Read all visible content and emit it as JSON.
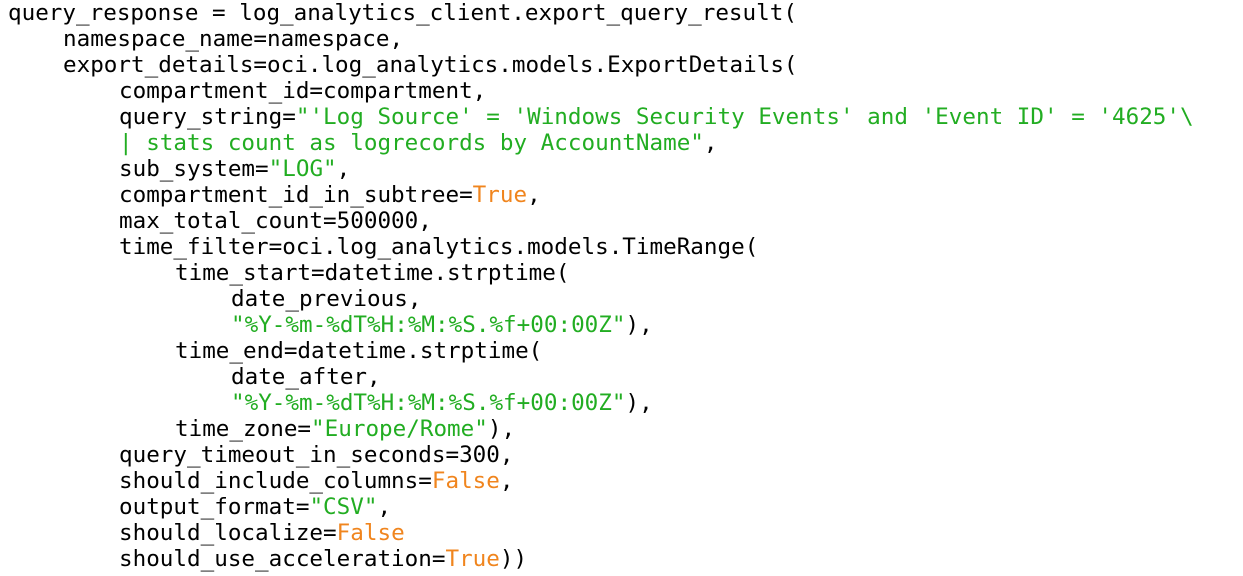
{
  "colors": {
    "background": "#ffffff",
    "default_text": "#000000",
    "string": "#22ad22",
    "keyword": "#f0851e"
  },
  "code_lines": [
    {
      "indent": 0,
      "tokens": [
        {
          "t": "plain",
          "v": "query_response = log_analytics_client.export_query_result("
        }
      ]
    },
    {
      "indent": 1,
      "tokens": [
        {
          "t": "plain",
          "v": "namespace_name=namespace,"
        }
      ]
    },
    {
      "indent": 1,
      "tokens": [
        {
          "t": "plain",
          "v": "export_details=oci.log_analytics.models.ExportDetails("
        }
      ]
    },
    {
      "indent": 2,
      "tokens": [
        {
          "t": "plain",
          "v": "compartment_id=compartment,"
        }
      ]
    },
    {
      "indent": 2,
      "tokens": [
        {
          "t": "plain",
          "v": "query_string="
        },
        {
          "t": "string",
          "v": "\"'Log Source' = 'Windows Security Events' and 'Event ID' = '4625'\\"
        }
      ]
    },
    {
      "indent": 2,
      "tokens": [
        {
          "t": "string",
          "v": "| stats count as logrecords by AccountName\""
        },
        {
          "t": "plain",
          "v": ","
        }
      ]
    },
    {
      "indent": 2,
      "tokens": [
        {
          "t": "plain",
          "v": "sub_system="
        },
        {
          "t": "string",
          "v": "\"LOG\""
        },
        {
          "t": "plain",
          "v": ","
        }
      ]
    },
    {
      "indent": 2,
      "tokens": [
        {
          "t": "plain",
          "v": "compartment_id_in_subtree="
        },
        {
          "t": "keyword",
          "v": "True"
        },
        {
          "t": "plain",
          "v": ","
        }
      ]
    },
    {
      "indent": 2,
      "tokens": [
        {
          "t": "plain",
          "v": "max_total_count=500000,"
        }
      ]
    },
    {
      "indent": 2,
      "tokens": [
        {
          "t": "plain",
          "v": "time_filter=oci.log_analytics.models.TimeRange("
        }
      ]
    },
    {
      "indent": 3,
      "tokens": [
        {
          "t": "plain",
          "v": "time_start=datetime.strptime("
        }
      ]
    },
    {
      "indent": 4,
      "tokens": [
        {
          "t": "plain",
          "v": "date_previous,"
        }
      ]
    },
    {
      "indent": 4,
      "tokens": [
        {
          "t": "string",
          "v": "\"%Y-%m-%dT%H:%M:%S.%f+00:00Z\""
        },
        {
          "t": "plain",
          "v": "),"
        }
      ]
    },
    {
      "indent": 3,
      "tokens": [
        {
          "t": "plain",
          "v": "time_end=datetime.strptime("
        }
      ]
    },
    {
      "indent": 4,
      "tokens": [
        {
          "t": "plain",
          "v": "date_after,"
        }
      ]
    },
    {
      "indent": 4,
      "tokens": [
        {
          "t": "string",
          "v": "\"%Y-%m-%dT%H:%M:%S.%f+00:00Z\""
        },
        {
          "t": "plain",
          "v": "),"
        }
      ]
    },
    {
      "indent": 3,
      "tokens": [
        {
          "t": "plain",
          "v": "time_zone="
        },
        {
          "t": "string",
          "v": "\"Europe/Rome\""
        },
        {
          "t": "plain",
          "v": "),"
        }
      ]
    },
    {
      "indent": 2,
      "tokens": [
        {
          "t": "plain",
          "v": "query_timeout_in_seconds=300,"
        }
      ]
    },
    {
      "indent": 2,
      "tokens": [
        {
          "t": "plain",
          "v": "should_include_columns="
        },
        {
          "t": "keyword",
          "v": "False"
        },
        {
          "t": "plain",
          "v": ","
        }
      ]
    },
    {
      "indent": 2,
      "tokens": [
        {
          "t": "plain",
          "v": "output_format="
        },
        {
          "t": "string",
          "v": "\"CSV\""
        },
        {
          "t": "plain",
          "v": ","
        }
      ]
    },
    {
      "indent": 2,
      "tokens": [
        {
          "t": "plain",
          "v": "should_localize="
        },
        {
          "t": "keyword",
          "v": "False"
        }
      ]
    },
    {
      "indent": 2,
      "tokens": [
        {
          "t": "plain",
          "v": "should_use_acceleration="
        },
        {
          "t": "keyword",
          "v": "True"
        },
        {
          "t": "plain",
          "v": "))"
        }
      ]
    }
  ]
}
